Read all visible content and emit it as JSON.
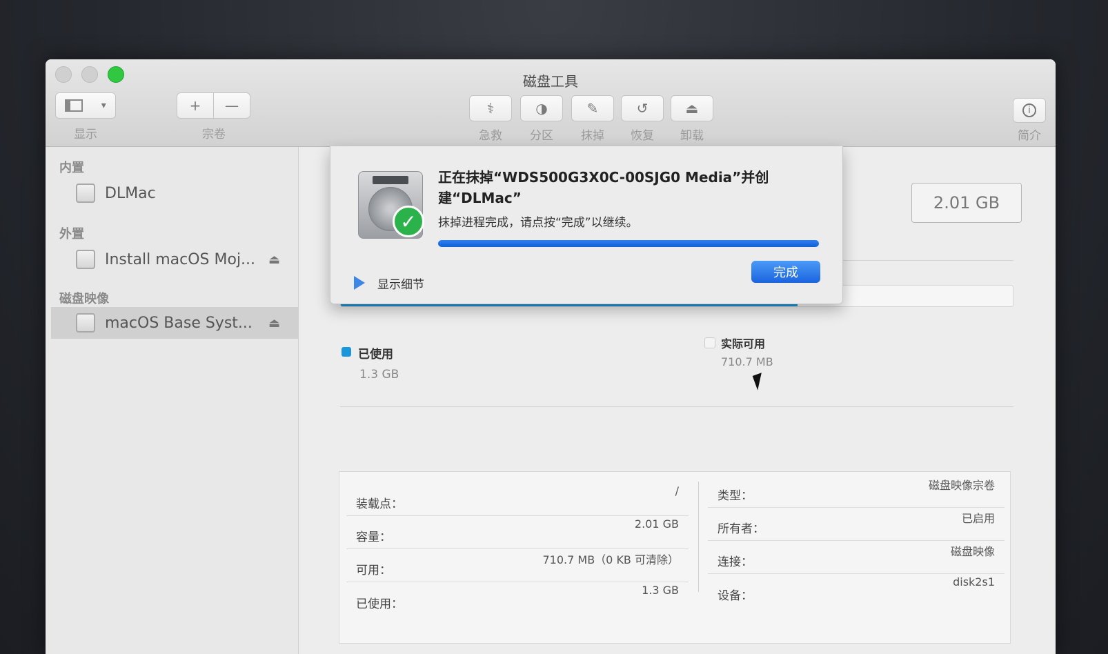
{
  "window": {
    "title": "磁盘工具"
  },
  "toolbar": {
    "view_label": "显示",
    "volume_label": "宗卷",
    "add_symbol": "+",
    "remove_symbol": "—",
    "buttons": [
      {
        "label": "急救",
        "icon": "stethoscope-icon"
      },
      {
        "label": "分区",
        "icon": "partition-pie-icon"
      },
      {
        "label": "抹掉",
        "icon": "erase-pencil-icon"
      },
      {
        "label": "恢复",
        "icon": "restore-arrow-icon"
      },
      {
        "label": "卸载",
        "icon": "unmount-icon"
      }
    ],
    "info_label": "简介"
  },
  "sidebar": {
    "sections": [
      {
        "title": "内置",
        "items": [
          {
            "label": "DLMac",
            "eject": false
          }
        ]
      },
      {
        "title": "外置",
        "items": [
          {
            "label": "Install macOS Moj...",
            "eject": true
          }
        ]
      },
      {
        "title": "磁盘映像",
        "items": [
          {
            "label": "macOS Base Syst...",
            "eject": true,
            "selected": true
          }
        ]
      }
    ]
  },
  "main": {
    "capacity": "2.01 GB",
    "usage_fraction": 0.68,
    "used_label": "已使用",
    "used_value": "1.3 GB",
    "available_label": "实际可用",
    "available_value": "710.7 MB",
    "left_rows": [
      {
        "key": "装载点：",
        "value": "/"
      },
      {
        "key": "容量：",
        "value": "2.01 GB"
      },
      {
        "key": "可用：",
        "value": "710.7 MB（0 KB 可清除）"
      },
      {
        "key": "已使用：",
        "value": "1.3 GB"
      }
    ],
    "right_rows": [
      {
        "key": "类型：",
        "value": "磁盘映像宗卷"
      },
      {
        "key": "所有者：",
        "value": "已启用"
      },
      {
        "key": "连接：",
        "value": "磁盘映像"
      },
      {
        "key": "设备：",
        "value": "disk2s1"
      }
    ]
  },
  "sheet": {
    "title": "正在抹掉“WDS500G3X0C-00SJG0 Media”并创建“DLMac”",
    "message": "抹掉进程完成，请点按“完成”以继续。",
    "progress": 1.0,
    "details_label": "显示细节",
    "done_label": "完成"
  },
  "colors": {
    "accent": "#1a96dd",
    "button_blue": "#1a64e0",
    "check_green": "#2bb24a"
  }
}
